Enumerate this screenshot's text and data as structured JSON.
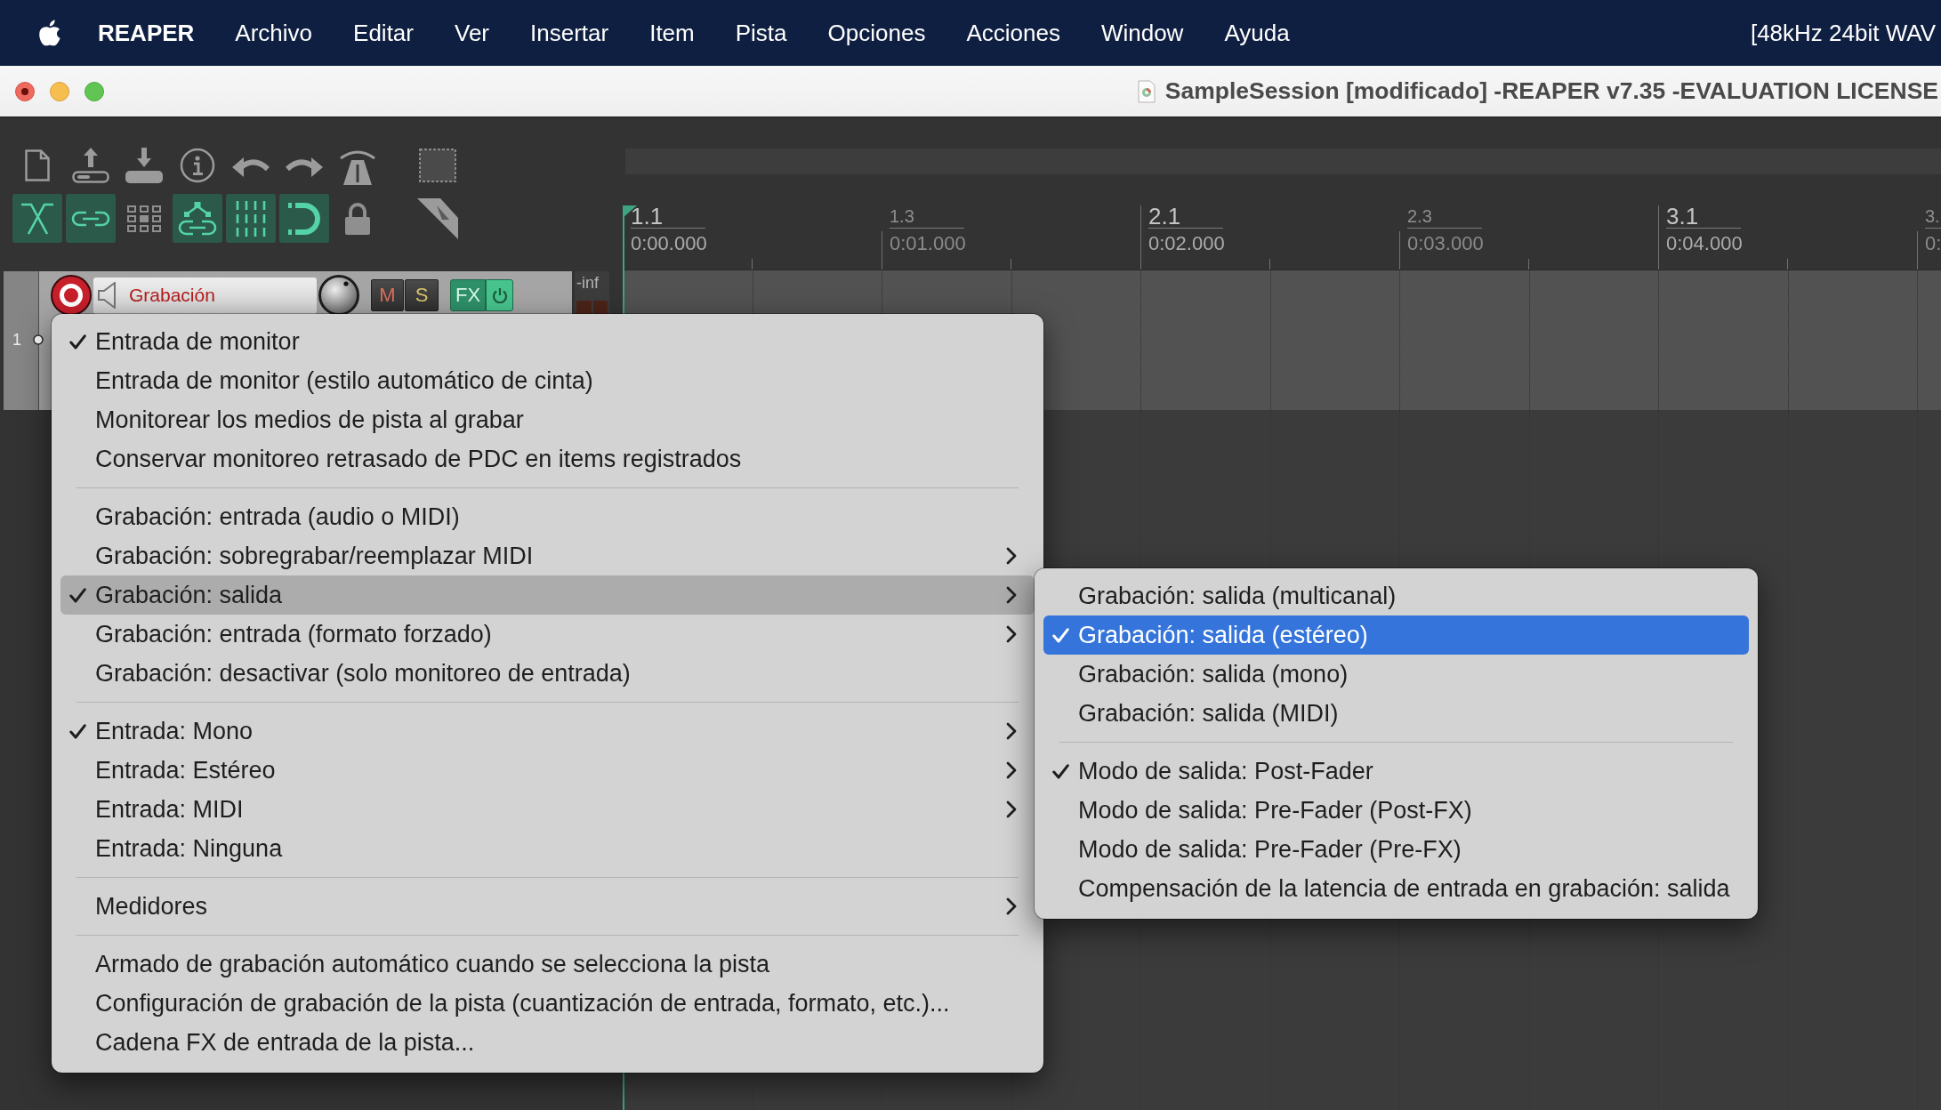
{
  "menu_bar": {
    "app_name": "REAPER",
    "items": [
      "Archivo",
      "Editar",
      "Ver",
      "Insertar",
      "Item",
      "Pista",
      "Opciones",
      "Acciones",
      "Window",
      "Ayuda"
    ],
    "status": "[48kHz 24bit WAV"
  },
  "window": {
    "title": "SampleSession [modificado] -REAPER v7.35 -EVALUATION LICENSE",
    "edited": true
  },
  "toolbar": {
    "toggles": [
      {
        "kind": "crossfade",
        "on": true
      },
      {
        "kind": "link",
        "on": true
      },
      {
        "kind": "grid",
        "on": false
      },
      {
        "kind": "group",
        "on": true
      },
      {
        "kind": "lines",
        "on": true
      },
      {
        "kind": "magnet",
        "on": true
      },
      {
        "kind": "lock",
        "on": false
      }
    ]
  },
  "ruler": {
    "marks": [
      {
        "kind": "bar",
        "label": "1.1",
        "time": "0:00.000"
      },
      {
        "kind": "beat",
        "label": "1.3",
        "time": "0:01.000"
      },
      {
        "kind": "bar",
        "label": "2.1",
        "time": "0:02.000"
      },
      {
        "kind": "beat",
        "label": "2.3",
        "time": "0:03.000"
      },
      {
        "kind": "bar",
        "label": "3.1",
        "time": "0:04.000"
      },
      {
        "kind": "beat",
        "label": "3.",
        "time": "0:"
      }
    ]
  },
  "track": {
    "number": "1",
    "name": "Grabación",
    "record_armed": true,
    "mute": {
      "label": "M",
      "on": false
    },
    "solo": {
      "label": "S",
      "on": false
    },
    "fx": {
      "label": "FX",
      "enabled": true
    },
    "meter_reading": "-inf"
  },
  "context_menu": {
    "focused": false,
    "groups": [
      [
        {
          "label": "Entrada de monitor",
          "checked": true,
          "submenu": false,
          "selected": false
        },
        {
          "label": "Entrada de monitor (estilo automático de cinta)",
          "checked": false,
          "submenu": false,
          "selected": false
        },
        {
          "label": "Monitorear los medios de pista al grabar",
          "checked": false,
          "submenu": false,
          "selected": false
        },
        {
          "label": "Conservar monitoreo retrasado de PDC en items registrados",
          "checked": false,
          "submenu": false,
          "selected": false
        }
      ],
      [
        {
          "label": "Grabación: entrada (audio o MIDI)",
          "checked": false,
          "submenu": false,
          "selected": false
        },
        {
          "label": "Grabación: sobregrabar/reemplazar MIDI",
          "checked": false,
          "submenu": true,
          "selected": false
        },
        {
          "label": "Grabación: salida",
          "checked": true,
          "submenu": true,
          "selected": true
        },
        {
          "label": "Grabación: entrada (formato forzado)",
          "checked": false,
          "submenu": true,
          "selected": false
        },
        {
          "label": "Grabación: desactivar (solo monitoreo de entrada)",
          "checked": false,
          "submenu": false,
          "selected": false
        }
      ],
      [
        {
          "label": "Entrada: Mono",
          "checked": true,
          "submenu": true,
          "selected": false
        },
        {
          "label": "Entrada: Estéreo",
          "checked": false,
          "submenu": true,
          "selected": false
        },
        {
          "label": "Entrada: MIDI",
          "checked": false,
          "submenu": true,
          "selected": false
        },
        {
          "label": "Entrada: Ninguna",
          "checked": false,
          "submenu": false,
          "selected": false
        }
      ],
      [
        {
          "label": "Medidores",
          "checked": false,
          "submenu": true,
          "selected": false
        }
      ],
      [
        {
          "label": "Armado de grabación automático cuando se selecciona la pista",
          "checked": false,
          "submenu": false,
          "selected": false
        },
        {
          "label": "Configuración de grabación de la pista (cuantización de entrada, formato, etc.)...",
          "checked": false,
          "submenu": false,
          "selected": false
        },
        {
          "label": "Cadena FX de entrada de la pista...",
          "checked": false,
          "submenu": false,
          "selected": false
        }
      ]
    ]
  },
  "submenu": {
    "focused": true,
    "groups": [
      [
        {
          "label": "Grabación: salida (multicanal)",
          "checked": false,
          "submenu": false,
          "selected": false
        },
        {
          "label": "Grabación: salida (estéreo)",
          "checked": true,
          "submenu": false,
          "selected": true
        },
        {
          "label": "Grabación: salida (mono)",
          "checked": false,
          "submenu": false,
          "selected": false
        },
        {
          "label": "Grabación: salida (MIDI)",
          "checked": false,
          "submenu": false,
          "selected": false
        }
      ],
      [
        {
          "label": "Modo de salida: Post-Fader",
          "checked": true,
          "submenu": false,
          "selected": false
        },
        {
          "label": "Modo de salida: Pre-Fader (Post-FX)",
          "checked": false,
          "submenu": false,
          "selected": false
        },
        {
          "label": "Modo de salida: Pre-Fader (Pre-FX)",
          "checked": false,
          "submenu": false,
          "selected": false
        },
        {
          "label": "Compensación de la latencia de entrada en grabación: salida",
          "checked": false,
          "submenu": false,
          "selected": false
        }
      ]
    ]
  }
}
